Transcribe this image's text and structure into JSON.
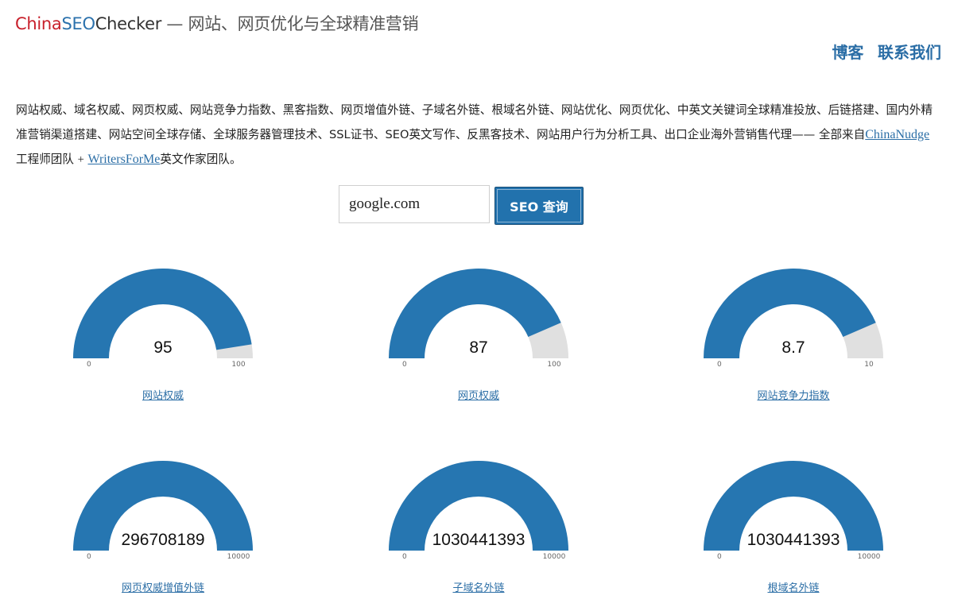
{
  "header": {
    "brand_part1": "China",
    "brand_part2": "SEO",
    "brand_part3": "Checker",
    "tagline": " — 网站、网页优化与全球精准营销",
    "nav": [
      "博客",
      "联系我们"
    ]
  },
  "intro": {
    "text": "网站权威、域名权威、网页权威、网站竞争力指数、黑客指数、网页增值外链、子域名外链、根域名外链、网站优化、网页优化、中英文关键词全球精准投放、后链搭建、国内外精准营销渠道搭建、网站空间全球存储、全球服务器管理技术、SSL证书、SEO英文写作、反黑客技术、网站用户行为分析工具、出口企业海外营销售代理—— 全部来自",
    "link1": "ChinaNudge",
    "mid": "工程师团队 ",
    "plus": "+",
    "link2": "WritersForMe",
    "end": "英文作家团队。"
  },
  "search": {
    "value": "google.com",
    "button_label": "SEO 查询"
  },
  "colors": {
    "fill": "#2676b1",
    "track": "#e0e0e0",
    "link": "#2b6ea6"
  },
  "gauges": [
    {
      "value": 95,
      "display": "95",
      "min": "0",
      "max": "100",
      "fraction": 0.95,
      "label": "网站权威"
    },
    {
      "value": 87,
      "display": "87",
      "min": "0",
      "max": "100",
      "fraction": 0.87,
      "label": "网页权威"
    },
    {
      "value": 8.7,
      "display": "8.7",
      "min": "0",
      "max": "10",
      "fraction": 0.87,
      "label": "网站竞争力指数"
    },
    {
      "value": 296708189,
      "display": "296708189",
      "min": "0",
      "max": "10000",
      "fraction": 1.0,
      "label": "网页权威增值外链"
    },
    {
      "value": 1030441393,
      "display": "1030441393",
      "min": "0",
      "max": "10000",
      "fraction": 1.0,
      "label": "子域名外链"
    },
    {
      "value": 1030441393,
      "display": "1030441393",
      "min": "0",
      "max": "10000",
      "fraction": 1.0,
      "label": "根域名外链"
    }
  ]
}
